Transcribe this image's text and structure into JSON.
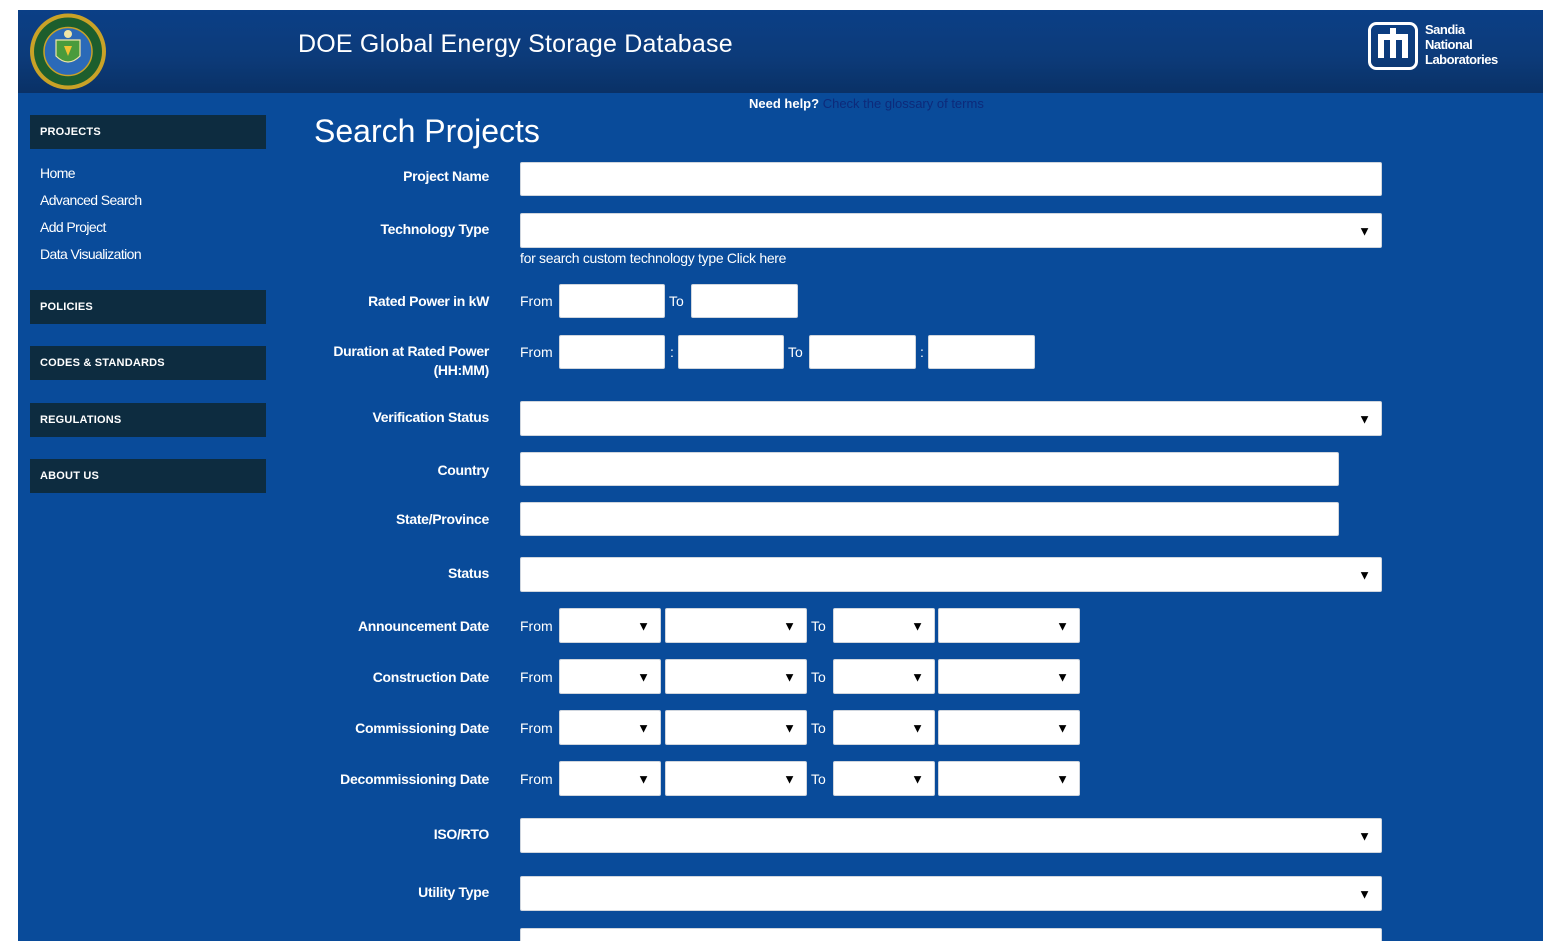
{
  "header": {
    "title": "DOE Global Energy Storage Database",
    "seal_icon": "doe-seal-icon",
    "sandia_icon": "sandia-thunderbird-icon",
    "sandia_lines": [
      "Sandia",
      "National",
      "Laboratories"
    ]
  },
  "sidebar": {
    "sections": [
      "PROJECTS",
      "POLICIES",
      "CODES & STANDARDS",
      "REGULATIONS",
      "ABOUT US"
    ],
    "project_links": [
      "Home",
      "Advanced Search",
      "Add Project",
      "Data Visualization"
    ]
  },
  "help": {
    "label": "Need help?",
    "link": "Check the glossary of terms"
  },
  "page_title": "Search Projects",
  "form": {
    "project_name": {
      "label": "Project Name",
      "value": ""
    },
    "technology_type": {
      "label": "Technology Type",
      "value": "",
      "hint": "for search custom technology type Click here"
    },
    "rated_power": {
      "label": "Rated Power in kW",
      "from": "From",
      "to": "To"
    },
    "duration": {
      "label_line1": "Duration at Rated Power",
      "label_line2": "(HH:MM)",
      "from": "From",
      "to": "To",
      "separator": ":"
    },
    "verification_status": {
      "label": "Verification Status",
      "value": ""
    },
    "country": {
      "label": "Country",
      "value": ""
    },
    "state_province": {
      "label": "State/Province",
      "value": ""
    },
    "status": {
      "label": "Status",
      "value": ""
    },
    "date_rows": [
      {
        "label": "Announcement Date",
        "from": "From",
        "to": "To"
      },
      {
        "label": "Construction Date",
        "from": "From",
        "to": "To"
      },
      {
        "label": "Commissioning Date",
        "from": "From",
        "to": "To"
      },
      {
        "label": "Decommissioning Date",
        "from": "From",
        "to": "To"
      }
    ],
    "iso_rto": {
      "label": "ISO/RTO",
      "value": ""
    },
    "utility_type": {
      "label": "Utility Type",
      "value": ""
    },
    "dropdown_arrow": "▼"
  },
  "colors": {
    "page_background": "#094b9a",
    "header_background": "#0c3b7a",
    "nav_header_background": "#0d2c40",
    "help_link": "#0d2a7a"
  }
}
